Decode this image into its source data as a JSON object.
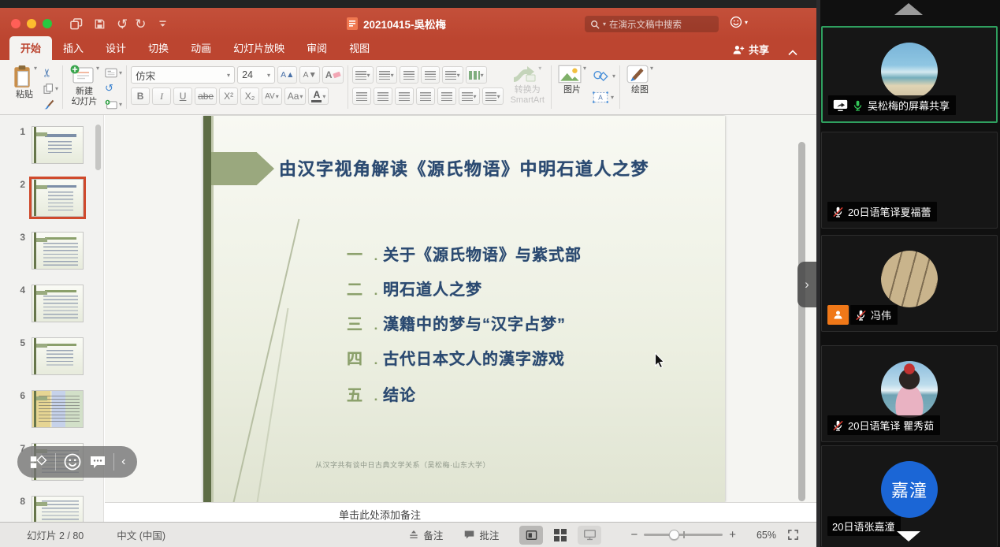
{
  "titlebar": {
    "title": "20210415-吳松梅",
    "search_placeholder": "在演示文稿中搜索",
    "share_label": "共享"
  },
  "tabs": {
    "items": [
      "开始",
      "插入",
      "设计",
      "切换",
      "动画",
      "幻灯片放映",
      "审阅",
      "视图"
    ],
    "active": "开始"
  },
  "ribbon": {
    "paste_label": "粘贴",
    "new_slide_line1": "新建",
    "new_slide_line2": "幻灯片",
    "font_name": "仿宋",
    "font_size": "24",
    "bold": "B",
    "italic": "I",
    "underline": "U",
    "strikethrough": "abe",
    "superscript": "X²",
    "subscript": "X₂",
    "char_spacing": "AV",
    "change_case": "Aa",
    "font_color": "A",
    "grow_font": "A▲",
    "shrink_font": "A▼",
    "clear_format": "A",
    "smartart_line1": "转换为",
    "smartart_line2": "SmartArt",
    "picture_label": "图片",
    "draw_label": "绘图"
  },
  "thumbnails": {
    "numbers": [
      "1",
      "2",
      "3",
      "4",
      "5",
      "6",
      "7",
      "8"
    ],
    "selected": "2"
  },
  "slide": {
    "title": "由汉字视角解读《源氏物语》中明石道人之梦",
    "list_dot": ".",
    "items": [
      {
        "num": "一",
        "text": "关于《源氏物语》与紫式部"
      },
      {
        "num": "二",
        "text": "明石道人之梦"
      },
      {
        "num": "三",
        "text": "漢籍中的梦与“汉字占梦”"
      },
      {
        "num": "四",
        "text": "古代日本文人的漢字游戏"
      },
      {
        "num": "五",
        "text": "结论"
      }
    ],
    "footer": "从汉字共有谈中日古典文学关系（吴松梅·山东大学）"
  },
  "notes": {
    "placeholder": "单击此处添加备注"
  },
  "statusbar": {
    "slide_counter": "幻灯片 2 / 80",
    "language": "中文 (中国)",
    "notes_label": "备注",
    "comments_label": "批注",
    "zoom_level": "65%"
  },
  "meeting": {
    "participants": [
      {
        "name": "吴松梅的屏幕共享",
        "sharing": true,
        "muted": false,
        "active_speaker": true
      },
      {
        "name": "20日语笔译夏福蕾",
        "muted": true
      },
      {
        "name": "冯伟",
        "muted": true,
        "host_badge": true
      },
      {
        "name": "20日语笔译 瞿秀茹",
        "muted": true
      },
      {
        "name": "20日语张嘉潼",
        "avatar_text": "嘉潼"
      }
    ]
  },
  "colors": {
    "ppt_red": "#bc4530",
    "selection_orange": "#cf4a2c",
    "slide_title_navy": "#2b4a71",
    "list_number_green": "#8ba06b",
    "mic_active_green": "#34c759",
    "mute_slash_red": "#e03c31",
    "host_badge_orange": "#f07818",
    "avatar_blue": "#1b66d6",
    "active_tile_border": "#2fa05f"
  }
}
